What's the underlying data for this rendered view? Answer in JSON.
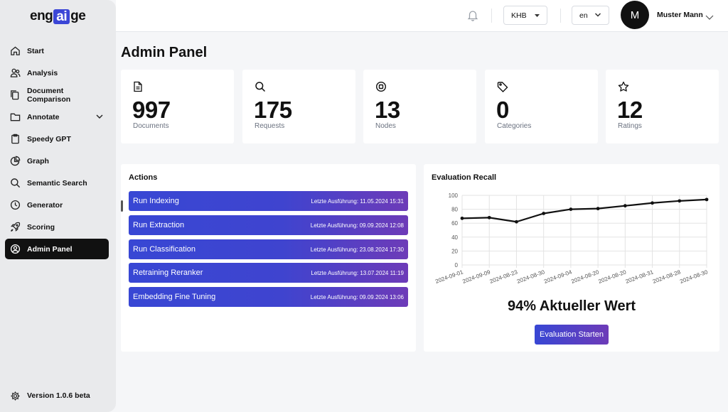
{
  "logo": {
    "pre": "eng",
    "ai": "ai",
    "post": "ge"
  },
  "sidebar": {
    "items": [
      {
        "label": "Start",
        "icon": "home-icon"
      },
      {
        "label": "Analysis",
        "icon": "users-icon"
      },
      {
        "label": "Document Comparison",
        "icon": "copy-icon"
      },
      {
        "label": "Annotate",
        "icon": "folder-icon"
      },
      {
        "label": "Speedy GPT",
        "icon": "clipboard-icon"
      },
      {
        "label": "Graph",
        "icon": "pie-chart-icon"
      },
      {
        "label": "Semantic Search",
        "icon": "search-icon"
      },
      {
        "label": "Generator",
        "icon": "clock-icon"
      },
      {
        "label": "Scoring",
        "icon": "rocket-icon"
      },
      {
        "label": "Admin Panel",
        "icon": "user-circle-icon"
      }
    ],
    "active": "Admin Panel",
    "version": "Version 1.0.6 beta"
  },
  "header": {
    "org_select": "KHB",
    "lang_select": "en",
    "avatar_initial": "M",
    "username": "Muster Mann"
  },
  "page_title": "Admin Panel",
  "stats": [
    {
      "value": "997",
      "label": "Documents",
      "icon": "document-icon"
    },
    {
      "value": "175",
      "label": "Requests",
      "icon": "search-icon"
    },
    {
      "value": "13",
      "label": "Nodes",
      "icon": "node-icon"
    },
    {
      "value": "0",
      "label": "Categories",
      "icon": "tag-icon"
    },
    {
      "value": "12",
      "label": "Ratings",
      "icon": "star-icon"
    }
  ],
  "actions": {
    "title": "Actions",
    "items": [
      {
        "name": "Run Indexing",
        "last_run": "Letzte Ausführung: 11.05.2024 15:31"
      },
      {
        "name": "Run Extraction",
        "last_run": "Letzte Ausführung: 09.09.2024 12:08"
      },
      {
        "name": "Run Classification",
        "last_run": "Letzte Ausführung: 23.08.2024 17:30"
      },
      {
        "name": "Retraining Reranker",
        "last_run": "Letzte Ausführung: 13.07.2024 11:19"
      },
      {
        "name": "Embedding Fine Tuning",
        "last_run": "Letzte Ausführung: 09.09.2024 13:06"
      }
    ]
  },
  "evaluation": {
    "title": "Evaluation Recall",
    "current_value": "94% Aktueller Wert",
    "button_label": "Evaluation Starten"
  },
  "chart_data": {
    "type": "line",
    "title": "",
    "xlabel": "",
    "ylabel": "",
    "ylim": [
      0,
      100
    ],
    "yticks": [
      0,
      20,
      40,
      60,
      80,
      100
    ],
    "grid": true,
    "x": [
      "2024-09-01",
      "2024-09-09",
      "2024-08-23",
      "2024-08-30",
      "2024-09-04",
      "2024-08-20",
      "2024-08-20",
      "2024-08-31",
      "2024-08-28",
      "2024-08-30"
    ],
    "values": [
      67,
      68,
      62,
      74,
      80,
      81,
      85,
      89,
      92,
      94
    ],
    "line_color": "#111111"
  },
  "colors": {
    "accent_start": "#3847d4",
    "accent_end": "#6d3bb8",
    "active_nav": "#111111"
  }
}
